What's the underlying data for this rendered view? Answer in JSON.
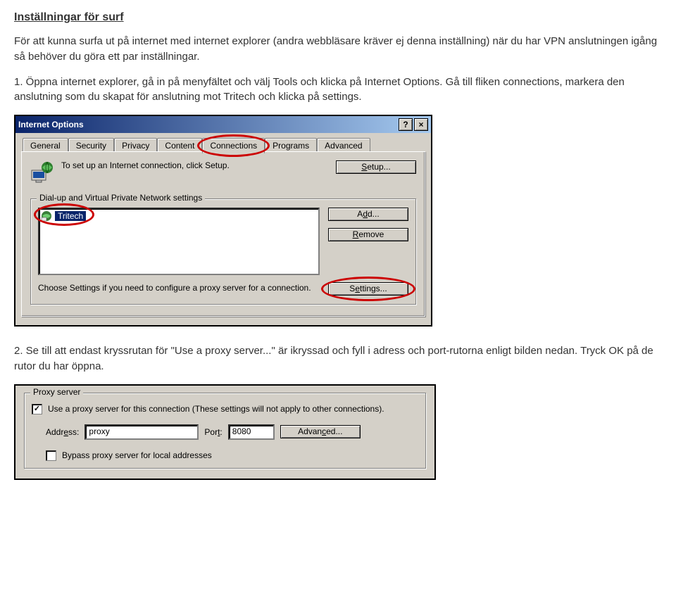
{
  "title": "Inställningar för surf",
  "intro": "För att kunna surfa ut på internet med internet explorer (andra webbläsare kräver ej denna inställning) när du har VPN anslutningen igång så behöver du göra ett par inställningar.",
  "step1": "1. Öppna internet explorer, gå in på menyfältet och välj Tools och klicka på Internet Options. Gå till fliken connections, markera den anslutning som du skapat för anslutning mot Tritech och klicka på settings.",
  "step2": "2. Se till att endast kryssrutan för \"Use a proxy server...\" är ikryssad och fyll i adress och port-rutorna enligt bilden nedan. Tryck OK på de rutor du har öppna.",
  "io": {
    "title": "Internet Options",
    "help_btn": "?",
    "close_btn": "×",
    "tabs": {
      "general": "General",
      "security": "Security",
      "privacy": "Privacy",
      "content": "Content",
      "connections": "Connections",
      "programs": "Programs",
      "advanced": "Advanced"
    },
    "setup_text": "To set up an Internet connection, click Setup.",
    "setup_btn": "Setup...",
    "group_title": "Dial-up and Virtual Private Network settings",
    "connection_item": "Tritech",
    "add_btn": "Add...",
    "remove_btn": "Remove",
    "choose_text": "Choose Settings if you need to configure a proxy server for a connection.",
    "settings_btn": "Settings..."
  },
  "px": {
    "group_title": "Proxy server",
    "use_proxy_label": "Use a proxy server for this connection (These settings will not apply to other connections).",
    "address_label_prefix": "Addr",
    "address_label_u": "e",
    "address_label_suffix": "ss:",
    "address_value": "proxy",
    "port_label_prefix": "Por",
    "port_label_u": "t",
    "port_label_suffix": ":",
    "port_value": "8080",
    "advanced_btn_prefix": "Advan",
    "advanced_btn_u": "c",
    "advanced_btn_suffix": "ed...",
    "bypass_label_prefix": "",
    "bypass_label_u": "B",
    "bypass_label_suffix": "ypass proxy server for local addresses"
  }
}
